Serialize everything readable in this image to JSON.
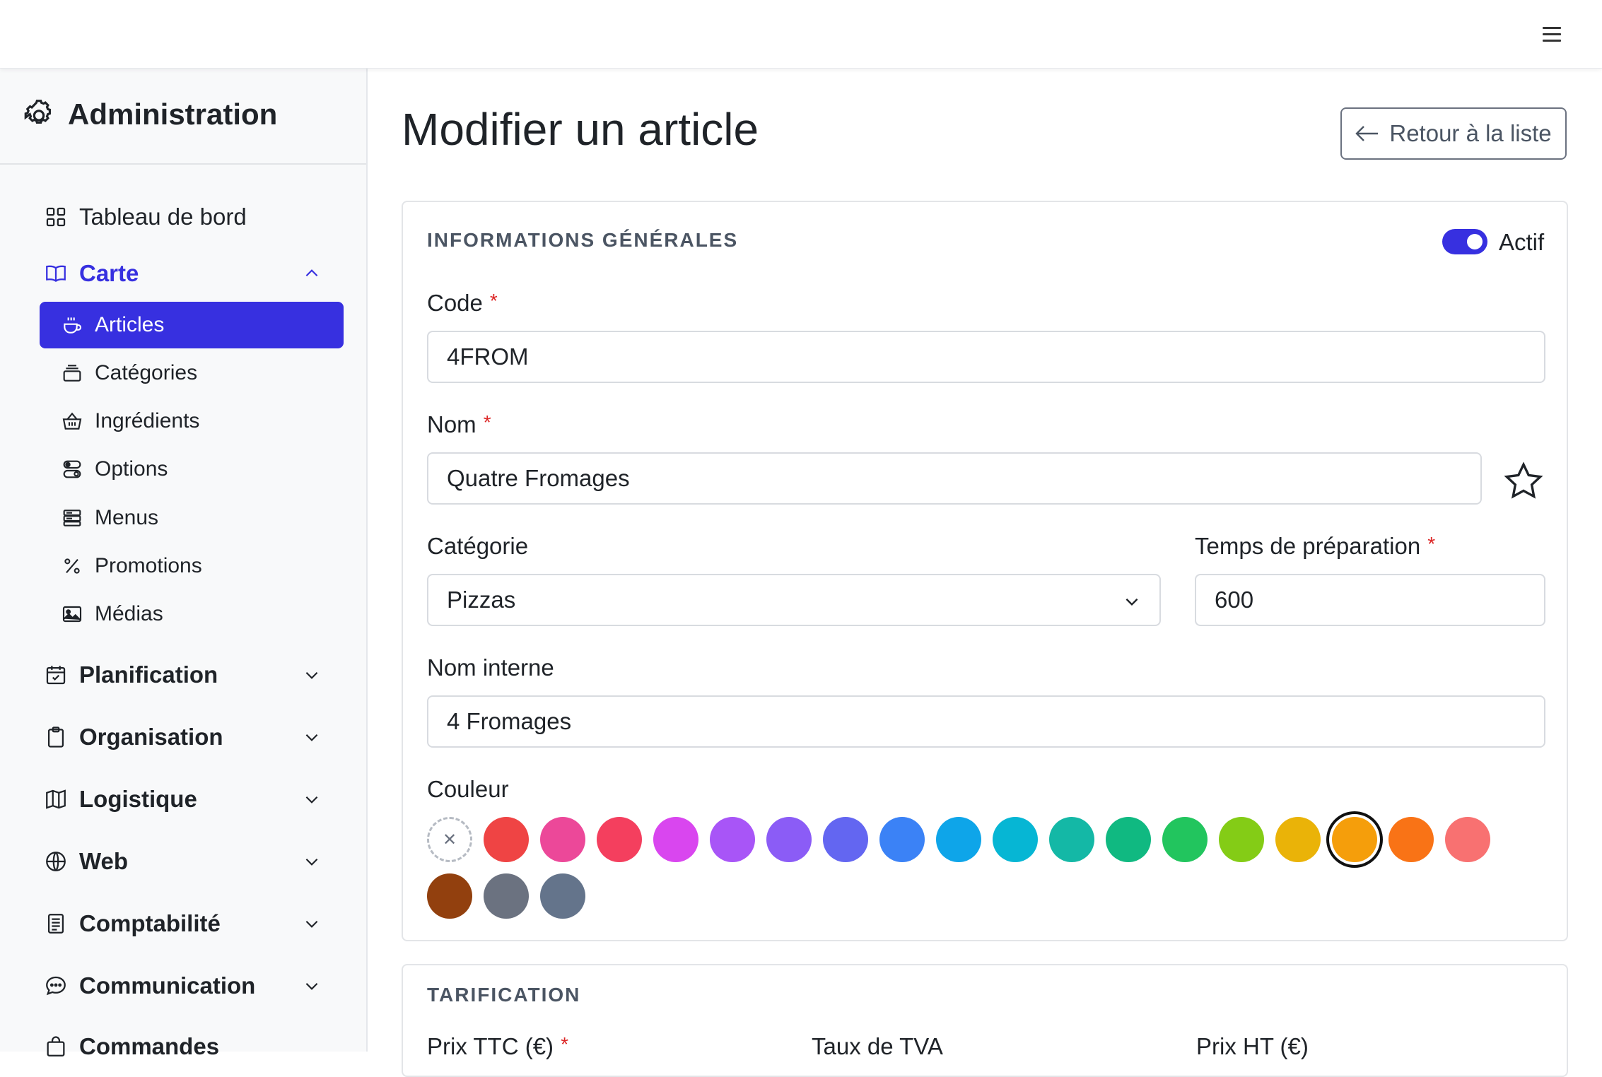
{
  "sidebar": {
    "brand": "Administration",
    "dashboard": "Tableau de bord",
    "carte": "Carte",
    "carte_items": [
      "Articles",
      "Catégories",
      "Ingrédients",
      "Options",
      "Menus",
      "Promotions",
      "Médias"
    ],
    "groups": [
      "Planification",
      "Organisation",
      "Logistique",
      "Web",
      "Comptabilité",
      "Communication",
      "Commandes"
    ]
  },
  "page": {
    "title": "Modifier un article",
    "back_button": "Retour à la liste"
  },
  "general": {
    "heading": "INFORMATIONS GÉNÉRALES",
    "active_label": "Actif",
    "active": true,
    "code_label": "Code",
    "code_value": "4FROM",
    "nom_label": "Nom",
    "nom_value": "Quatre Fromages",
    "categorie_label": "Catégorie",
    "categorie_value": "Pizzas",
    "temps_label": "Temps de préparation",
    "temps_value": "600",
    "nom_interne_label": "Nom interne",
    "nom_interne_value": "4 Fromages",
    "couleur_label": "Couleur",
    "required_mark": "*",
    "colors": [
      "#ef4444",
      "#ec4899",
      "#f43f5e",
      "#d946ef",
      "#a855f7",
      "#8b5cf6",
      "#6366f1",
      "#3b82f6",
      "#0ea5e9",
      "#06b6d4",
      "#14b8a6",
      "#10b981",
      "#22c55e",
      "#84cc16",
      "#eab308",
      "#f59e0b",
      "#f97316",
      "#f87171",
      "#92400e",
      "#6b7280",
      "#64748b"
    ],
    "selected_color": "#f59e0b"
  },
  "pricing": {
    "heading": "TARIFICATION",
    "prix_ttc_label": "Prix TTC (€)",
    "tva_label": "Taux de TVA",
    "prix_ht_label": "Prix HT (€)"
  }
}
